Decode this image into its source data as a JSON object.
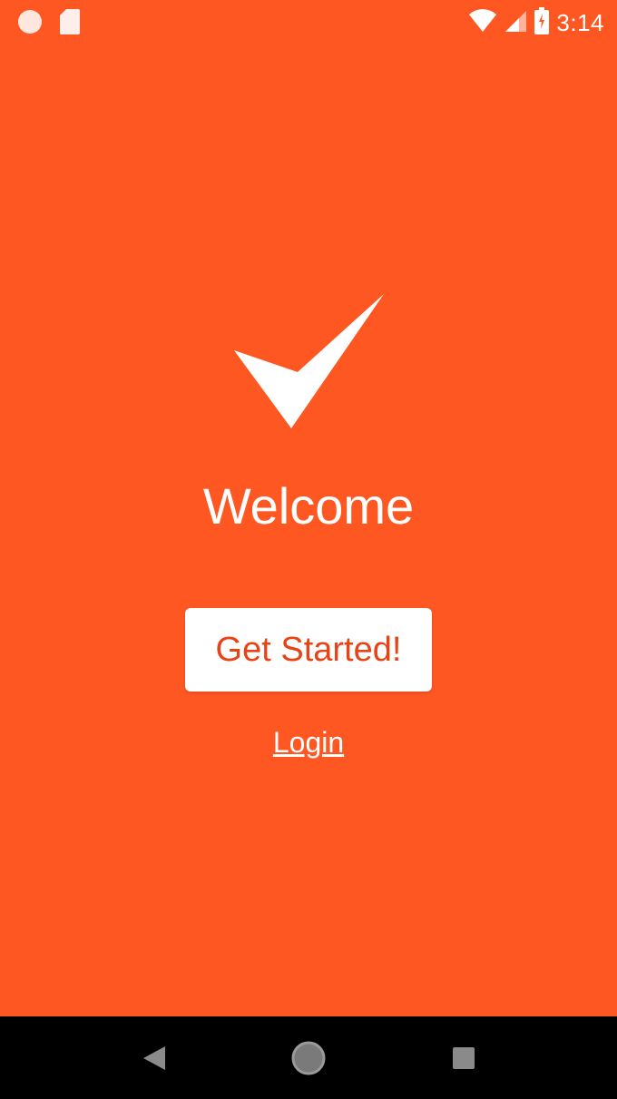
{
  "status_bar": {
    "time": "3:14",
    "left_icons": [
      "notification-dot-icon",
      "sd-card-icon"
    ],
    "right_icons": [
      "wifi-icon",
      "cell-signal-icon",
      "battery-icon"
    ]
  },
  "main": {
    "logo_icon": "checkmark-icon",
    "title": "Welcome",
    "get_started_label": "Get Started!",
    "login_label": "Login"
  },
  "nav_bar": {
    "icons": [
      "back-icon",
      "home-icon",
      "recents-icon"
    ]
  },
  "colors": {
    "background": "#FF5722",
    "button_text": "#E84316",
    "button_bg": "#FFFFFF",
    "nav_bg": "#000000"
  }
}
